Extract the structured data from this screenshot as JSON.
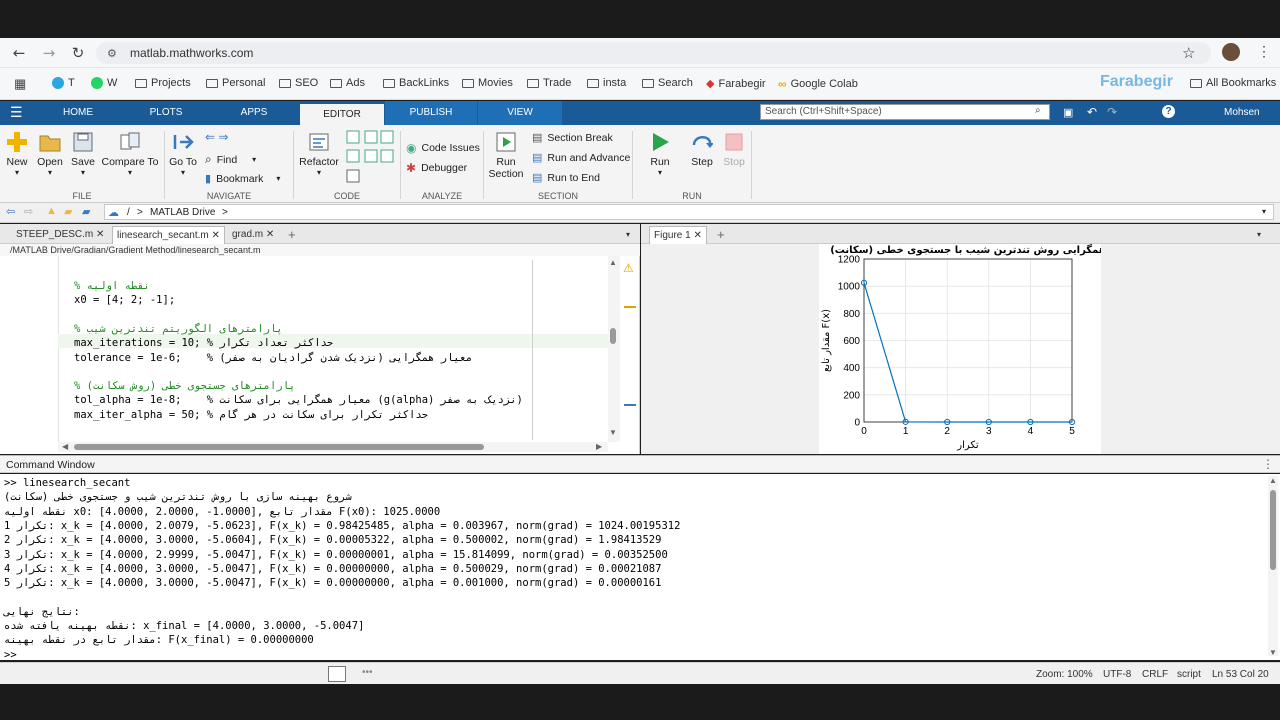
{
  "browser": {
    "url": "matlab.mathworks.com",
    "bookmarks": [
      "T",
      "W",
      "Projects",
      "Personal",
      "SEO",
      "Ads",
      "BackLinks",
      "Movies",
      "Trade",
      "insta",
      "Search",
      "Farabegir",
      "Google Colab"
    ],
    "all_bookmarks": "All Bookmarks",
    "watermark": "Farabegir"
  },
  "ribbon": {
    "tabs": [
      "HOME",
      "PLOTS",
      "APPS",
      "EDITOR",
      "PUBLISH",
      "VIEW"
    ],
    "active_tab": "EDITOR",
    "search_placeholder": "Search (Ctrl+Shift+Space)",
    "user": "Mohsen",
    "file": {
      "new": "New",
      "open": "Open",
      "save": "Save",
      "compare": "Compare To",
      "group": "FILE"
    },
    "navigate": {
      "goto": "Go To",
      "find": "Find",
      "bookmark": "Bookmark",
      "group": "NAVIGATE"
    },
    "code": {
      "refactor": "Refactor",
      "group": "CODE"
    },
    "analyze": {
      "issues": "Code Issues",
      "debugger": "Debugger",
      "group": "ANALYZE"
    },
    "section": {
      "run_section_1": "Run",
      "run_section_2": "Section",
      "break": "Section Break",
      "run_advance": "Run and Advance",
      "run_end": "Run to End",
      "group": "SECTION"
    },
    "run": {
      "run": "Run",
      "step": "Step",
      "stop": "Stop",
      "group": "RUN"
    }
  },
  "path": {
    "sep1": "/",
    "drive": "MATLAB Drive",
    "sep2": ">"
  },
  "editor": {
    "tabs": [
      "STEEP_DESC.m",
      "linesearch_secant.m",
      "grad.m"
    ],
    "file_path": "/MATLAB Drive/Gradian/Gradient Method/linesearch_secant.m",
    "lines": [
      {
        "c": "% نقطه اولیه",
        "k": "cm"
      },
      {
        "c": "x0 = [4; 2; -1];",
        "k": ""
      },
      {
        "c": "",
        "k": ""
      },
      {
        "c": "% پارامترهای الگوریتم تندترین شیب",
        "k": "cm"
      },
      {
        "c": "max_iterations = 10; % حداکثر تعداد تکرار",
        "k": ""
      },
      {
        "c": "tolerance = 1e-6;    % معیار همگرایی (نزدیک شدن گرادیان به صفر)",
        "k": ""
      },
      {
        "c": "",
        "k": ""
      },
      {
        "c": "% پارامترهای جستجوی خطی (روش سکانت)",
        "k": "cm"
      },
      {
        "c": "tol_alpha = 1e-8;    % معیار همگرایی برای سکانت (g(alpha) نزدیک به صفر)",
        "k": ""
      },
      {
        "c": "max_iter_alpha = 50; % حداکثر تکرار برای سکانت در هر گام",
        "k": ""
      }
    ]
  },
  "figure": {
    "tab": "Figure 1",
    "chart_data": {
      "type": "line",
      "title": "همگرایی روش تندترین شیب با جستجوی خطی (سکانت)",
      "xlabel": "تکرار",
      "ylabel": "مقدار تابع F(x)",
      "x": [
        0,
        1,
        2,
        3,
        4,
        5
      ],
      "y": [
        1025,
        0.98425485,
        5.322e-05,
        1e-08,
        0,
        0
      ],
      "xlim": [
        0,
        5
      ],
      "ylim": [
        0,
        1200
      ],
      "xticks": [
        "0",
        "1",
        "2",
        "3",
        "4",
        "5"
      ],
      "yticks": [
        "0",
        "200",
        "400",
        "600",
        "800",
        "1000",
        "1200"
      ],
      "grid": true,
      "color": "#0072bd"
    }
  },
  "command_window": {
    "title": "Command Window",
    "lines": [
      ">> linesearch_secant",
      "شروع بهینه سازی با روش تندترین شیب و جستجوی خطی (سکانت)",
      "نقطه اولیه x0: [4.0000, 2.0000, -1.0000], مقدار تابع F(x0): 1025.0000",
      "تکرار 1: x_k = [4.0000, 2.0079, -5.0623], F(x_k) = 0.98425485, alpha = 0.003967, norm(grad) = 1024.00195312",
      "تکرار 2: x_k = [4.0000, 3.0000, -5.0604], F(x_k) = 0.00005322, alpha = 0.500002, norm(grad) = 1.98413529",
      "تکرار 3: x_k = [4.0000, 2.9999, -5.0047], F(x_k) = 0.00000001, alpha = 15.814099, norm(grad) = 0.00352500",
      "تکرار 4: x_k = [4.0000, 3.0000, -5.0047], F(x_k) = 0.00000000, alpha = 0.500029, norm(grad) = 0.00021087",
      "تکرار 5: x_k = [4.0000, 3.0000, -5.0047], F(x_k) = 0.00000000, alpha = 0.001000, norm(grad) = 0.00000161",
      "",
      "نتایج نهایی:",
      "نقطه بهینه یافته شده: x_final = [4.0000, 3.0000, -5.0047]",
      "مقدار تابع در نقطه بهینه: F(x_final) = 0.00000000",
      ">>"
    ]
  },
  "status": {
    "zoom": "Zoom: 100%",
    "encoding": "UTF-8",
    "eol": "CRLF",
    "type": "script",
    "pos": "Ln 53  Col 20"
  }
}
